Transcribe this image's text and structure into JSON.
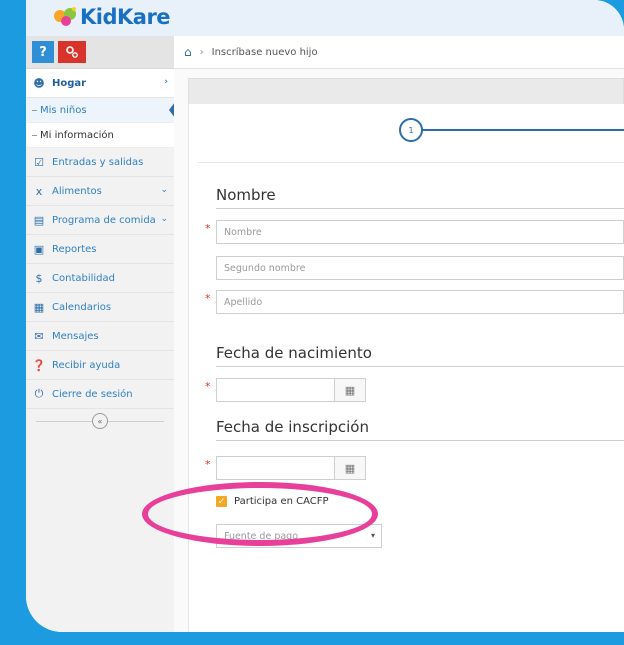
{
  "brand": {
    "name": "KidKare"
  },
  "sidebar": {
    "help_label": "?",
    "items": [
      {
        "label": "Hogar",
        "icon": "users-icon",
        "chevron": "›"
      },
      {
        "label": "Entradas y salidas",
        "icon": "checkbox-icon"
      },
      {
        "label": "Alimentos",
        "icon": "utensils-icon",
        "chevron": "⌄"
      },
      {
        "label": "Programa de comida",
        "icon": "id-card-icon",
        "chevron": "⌄"
      },
      {
        "label": "Reportes",
        "icon": "file-icon"
      },
      {
        "label": "Contabilidad",
        "icon": "dollar-icon"
      },
      {
        "label": "Calendarios",
        "icon": "calendar-icon"
      },
      {
        "label": "Mensajes",
        "icon": "envelope-icon"
      },
      {
        "label": "Recibir ayuda",
        "icon": "question-circle-icon"
      },
      {
        "label": "Cierre de sesión",
        "icon": "power-icon"
      }
    ],
    "sub_items": [
      {
        "label": "Mis niños",
        "selected": true
      },
      {
        "label": "Mi información",
        "selected": false
      }
    ],
    "collapse_symbol": "«"
  },
  "breadcrumb": {
    "current": "Inscríbase nuevo hijo"
  },
  "stepper": {
    "step": "1"
  },
  "form": {
    "name_section": "Nombre",
    "first_name_placeholder": "Nombre",
    "middle_name_placeholder": "Segundo nombre",
    "last_name_placeholder": "Apellido",
    "birth_section": "Fecha de nacimiento",
    "enroll_section": "Fecha de inscripción",
    "cacfp_label": "Participa en CACFP",
    "cacfp_checked": true,
    "payment_placeholder": "Fuente de pago",
    "required_mark": "*"
  },
  "colors": {
    "background": "#1d9be0",
    "accent": "#2e6ea8",
    "checkbox": "#f5a623",
    "highlight": "#e8409a",
    "required": "#d9342b"
  }
}
